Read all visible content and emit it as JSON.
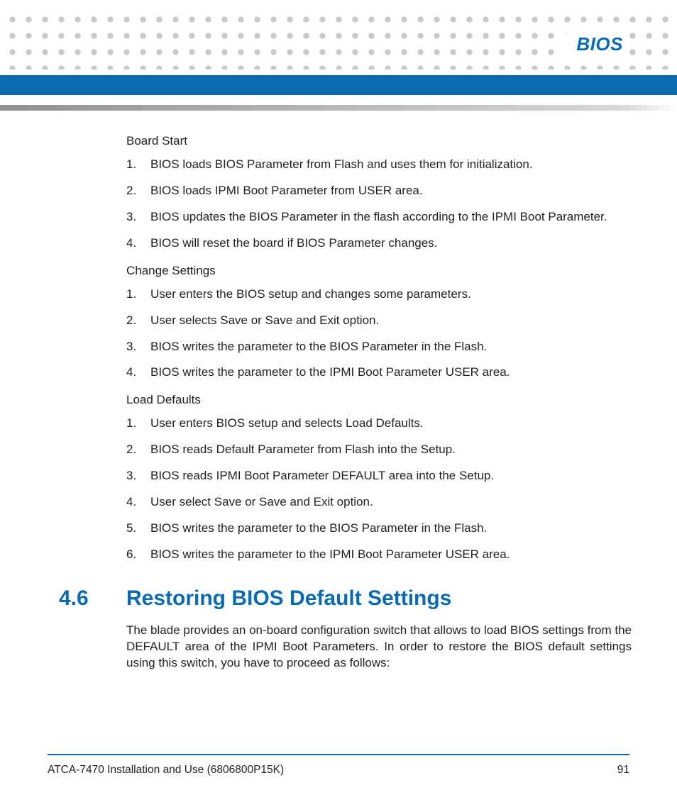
{
  "header": {
    "title": "BIOS"
  },
  "sections": {
    "boardStart": {
      "heading": "Board Start",
      "items": [
        "BIOS loads BIOS Parameter from Flash and uses them for initialization.",
        "BIOS loads IPMI Boot Parameter from USER area.",
        "BIOS updates the BIOS Parameter in the flash according to the IPMI Boot Parameter.",
        "BIOS will reset the board if BIOS Parameter changes."
      ]
    },
    "changeSettings": {
      "heading": "Change Settings",
      "items": [
        "User enters the BIOS setup and changes some parameters.",
        "User selects Save or Save and Exit option.",
        "BIOS writes the parameter to the BIOS Parameter in the Flash.",
        "BIOS writes the parameter to the IPMI Boot Parameter USER area."
      ]
    },
    "loadDefaults": {
      "heading": "Load Defaults",
      "items": [
        "User enters BIOS setup and selects Load Defaults.",
        "BIOS reads Default Parameter from Flash into the Setup.",
        "BIOS reads IPMI Boot Parameter DEFAULT area into the Setup.",
        "User select Save or Save and Exit option.",
        "BIOS writes the parameter to the BIOS Parameter in the Flash.",
        "BIOS writes the parameter to the IPMI Boot Parameter USER area."
      ]
    },
    "restore": {
      "number": "4.6",
      "title": "Restoring BIOS Default Settings",
      "body": "The blade provides an on-board configuration switch that allows to load BIOS settings from the DEFAULT area of the IPMI Boot Parameters. In order to restore the BIOS default settings using this switch, you have to proceed as follows:"
    }
  },
  "footer": {
    "docTitle": "ATCA-7470 Installation and Use (6806800P15K)",
    "pageNumber": "91"
  },
  "numbers": {
    "n1": "1.",
    "n2": "2.",
    "n3": "3.",
    "n4": "4.",
    "n5": "5.",
    "n6": "6."
  }
}
